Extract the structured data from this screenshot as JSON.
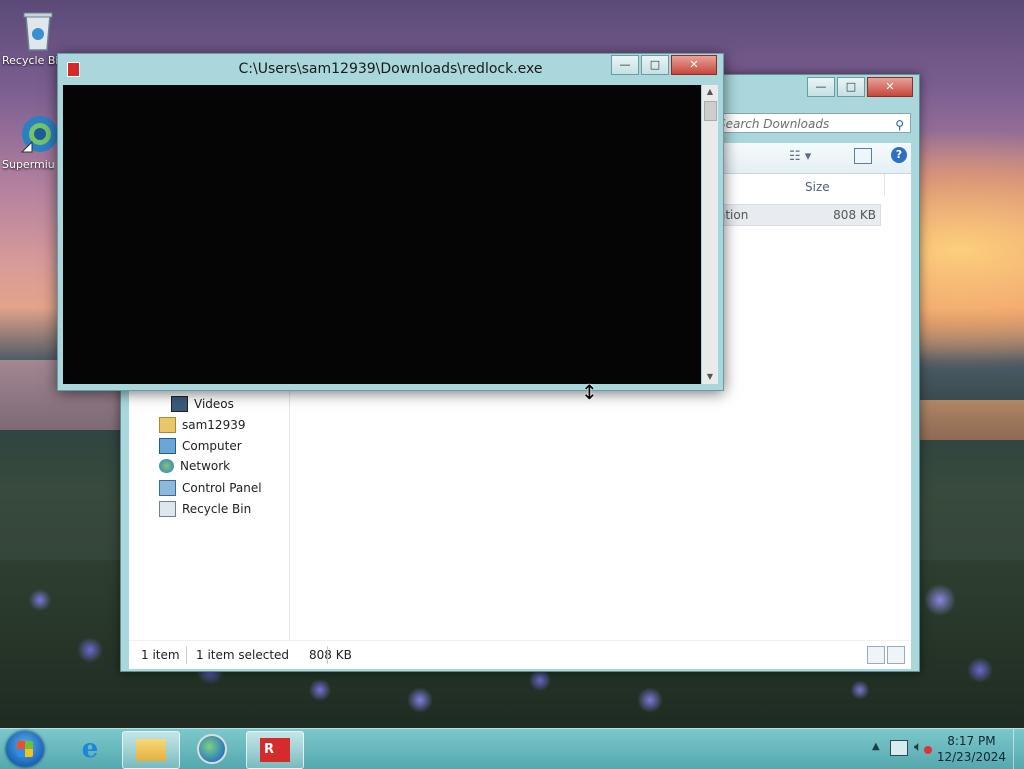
{
  "desktop": {
    "icons": [
      {
        "label": "Recycle Bin",
        "icon": "recycle-bin-icon"
      },
      {
        "label": "Supermium",
        "icon": "browser-icon"
      }
    ]
  },
  "explorer": {
    "search_placeholder": "Search Downloads",
    "column_size": "Size",
    "file_type_fragment": "ation",
    "file_size": "808 KB",
    "nav": [
      {
        "label": "Videos",
        "icon": "videos-icon"
      },
      {
        "label": "sam12939",
        "icon": "user-folder-icon"
      },
      {
        "label": "Computer",
        "icon": "computer-icon"
      },
      {
        "label": "Network",
        "icon": "network-icon"
      },
      {
        "label": "Control Panel",
        "icon": "control-panel-icon"
      },
      {
        "label": "Recycle Bin",
        "icon": "recycle-bin-icon"
      }
    ],
    "status": {
      "count": "1 item",
      "selected": "1 item selected",
      "size": "808 KB"
    }
  },
  "console": {
    "title": "C:\\Users\\sam12939\\Downloads\\redlock.exe"
  },
  "caption_buttons": {
    "minimize": "—",
    "maximize": "□",
    "close": "✕"
  },
  "taskbar": {
    "items": [
      "internet-explorer",
      "file-explorer",
      "supermium",
      "redlock"
    ],
    "clock_time": "8:17 PM",
    "clock_date": "12/23/2024"
  }
}
